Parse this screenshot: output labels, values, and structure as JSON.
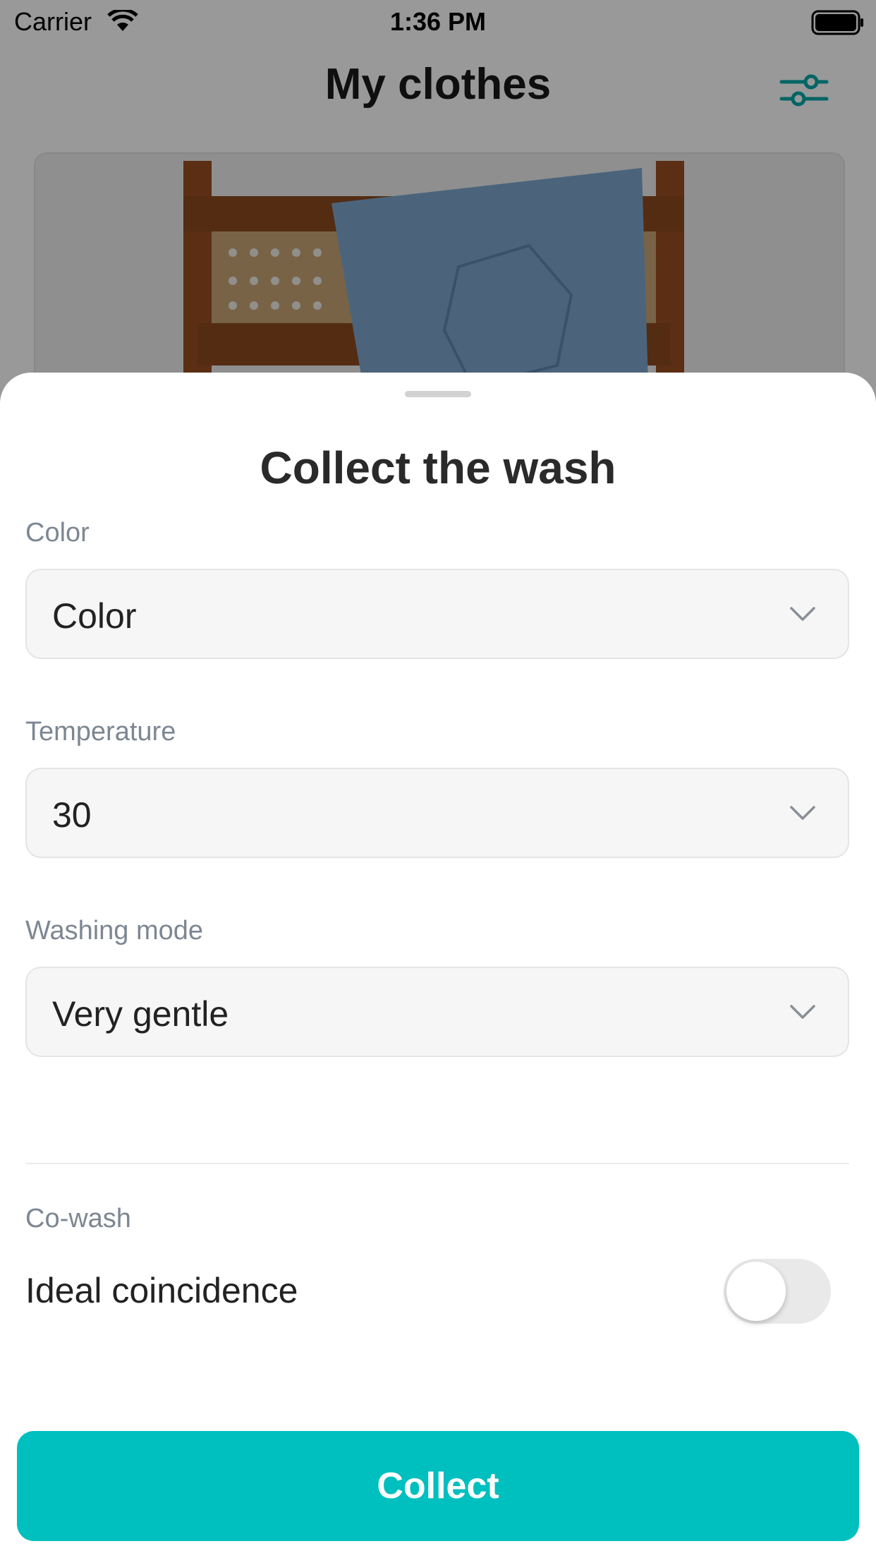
{
  "status_bar": {
    "carrier": "Carrier",
    "time": "1:36 PM"
  },
  "nav": {
    "title": "My clothes",
    "filter_icon": "sliders-icon"
  },
  "sheet": {
    "title": "Collect the wash",
    "fields": [
      {
        "label": "Color",
        "value": "Color"
      },
      {
        "label": "Temperature",
        "value": "30"
      },
      {
        "label": "Washing mode",
        "value": "Very gentle"
      }
    ],
    "cowash": {
      "section_label": "Co-wash",
      "toggle_label": "Ideal coincidence",
      "toggle_on": false
    },
    "collect_label": "Collect"
  },
  "colors": {
    "accent": "#00bfbf",
    "label": "#7d8793"
  }
}
